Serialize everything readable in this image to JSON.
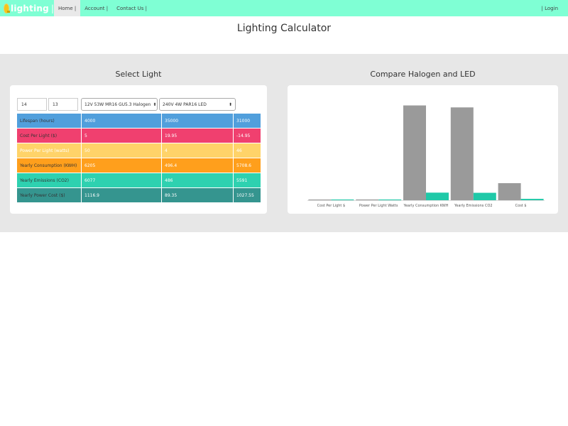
{
  "nav": {
    "brand": "lighting",
    "brand_sep": "|",
    "items": [
      "Home |",
      "Account |",
      "Contact Us |"
    ],
    "login": "| Login"
  },
  "page_title": "Lighting Calculator",
  "left_panel": {
    "title": "Select Light",
    "input1_value": "14",
    "input2_value": "13",
    "halogen_select": "12V 53W MR16 GU5.3 Halogen",
    "led_select": "240V 4W PAR16 LED",
    "rows": [
      {
        "label": "Lifespan (hours)",
        "halogen": "4000",
        "led": "35000",
        "diff": "31000",
        "color": "#519fdc"
      },
      {
        "label": "Cost Per Light ($)",
        "halogen": "5",
        "led": "19.95",
        "diff": "-14.95",
        "color": "#f0406f"
      },
      {
        "label": "Power Per Light (watts)",
        "halogen": "50",
        "led": "4",
        "diff": "46",
        "color": "#ffd369"
      },
      {
        "label": "Yearly Consumption (KWH)",
        "halogen": "6205",
        "led": "496.4",
        "diff": "5708.6",
        "color": "#ff9f1c"
      },
      {
        "label": "Yearly Emissions (CO2)",
        "halogen": "6077",
        "led": "486",
        "diff": "5591",
        "color": "#2ed1b0"
      },
      {
        "label": "Yearly Power Cost ($)",
        "halogen": "1116.9",
        "led": "89.35",
        "diff": "1027.55",
        "color": "#35958f"
      }
    ]
  },
  "right_panel": {
    "title": "Compare Halogen and LED"
  },
  "chart_data": {
    "type": "bar",
    "categories": [
      "Cost Per Light $",
      "Power Per Light Watts",
      "Yearly Consumption KWH",
      "Yearly Emissions CO2",
      "Cost $"
    ],
    "series": [
      {
        "values": [
          5,
          50,
          6205,
          6077,
          1116.9
        ],
        "color": "#9a9a9a"
      },
      {
        "values": [
          19.95,
          4,
          496.4,
          486,
          89.35
        ],
        "color": "#1fc9a8"
      }
    ],
    "ylim": [
      0,
      6600
    ],
    "grid": false,
    "legend": "none"
  }
}
